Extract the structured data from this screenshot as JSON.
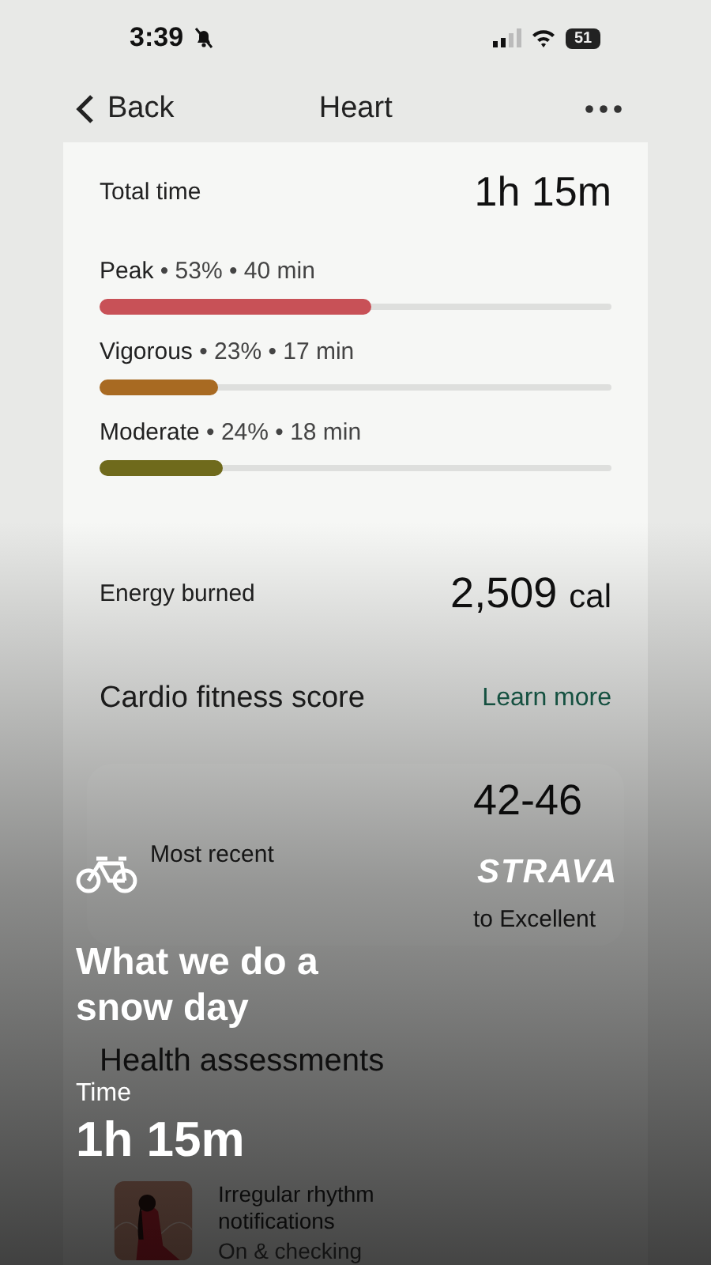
{
  "status_bar": {
    "time": "3:39",
    "silent": true,
    "battery": "51"
  },
  "nav": {
    "back": "Back",
    "title": "Heart"
  },
  "total_time": {
    "label": "Total time",
    "value": "1h 15m"
  },
  "zones": [
    {
      "name": "Peak",
      "detail": " • 53% • 40 min",
      "level": 0.53,
      "color": "#c85157"
    },
    {
      "name": "Vigorous",
      "detail": " • 23% • 17 min",
      "level": 0.23,
      "color": "#a86a22"
    },
    {
      "name": "Moderate",
      "detail": " • 24% • 18 min",
      "level": 0.24,
      "color": "#6f6a1c"
    }
  ],
  "energy": {
    "label": "Energy burned",
    "value": "2,509",
    "unit": "cal"
  },
  "cardio": {
    "title": "Cardio fitness score",
    "link": "Learn more",
    "recent_label": "Most recent",
    "score": "42-46",
    "rating": "to Excellent"
  },
  "health": {
    "title": "Health assessments",
    "card_title": "Irregular rhythm notifications",
    "card_status": "On & checking"
  },
  "overlay": {
    "logo": "STRAVA",
    "activity": "What we do a snow day",
    "stat_label": "Time",
    "stat_value": "1h 15m"
  }
}
